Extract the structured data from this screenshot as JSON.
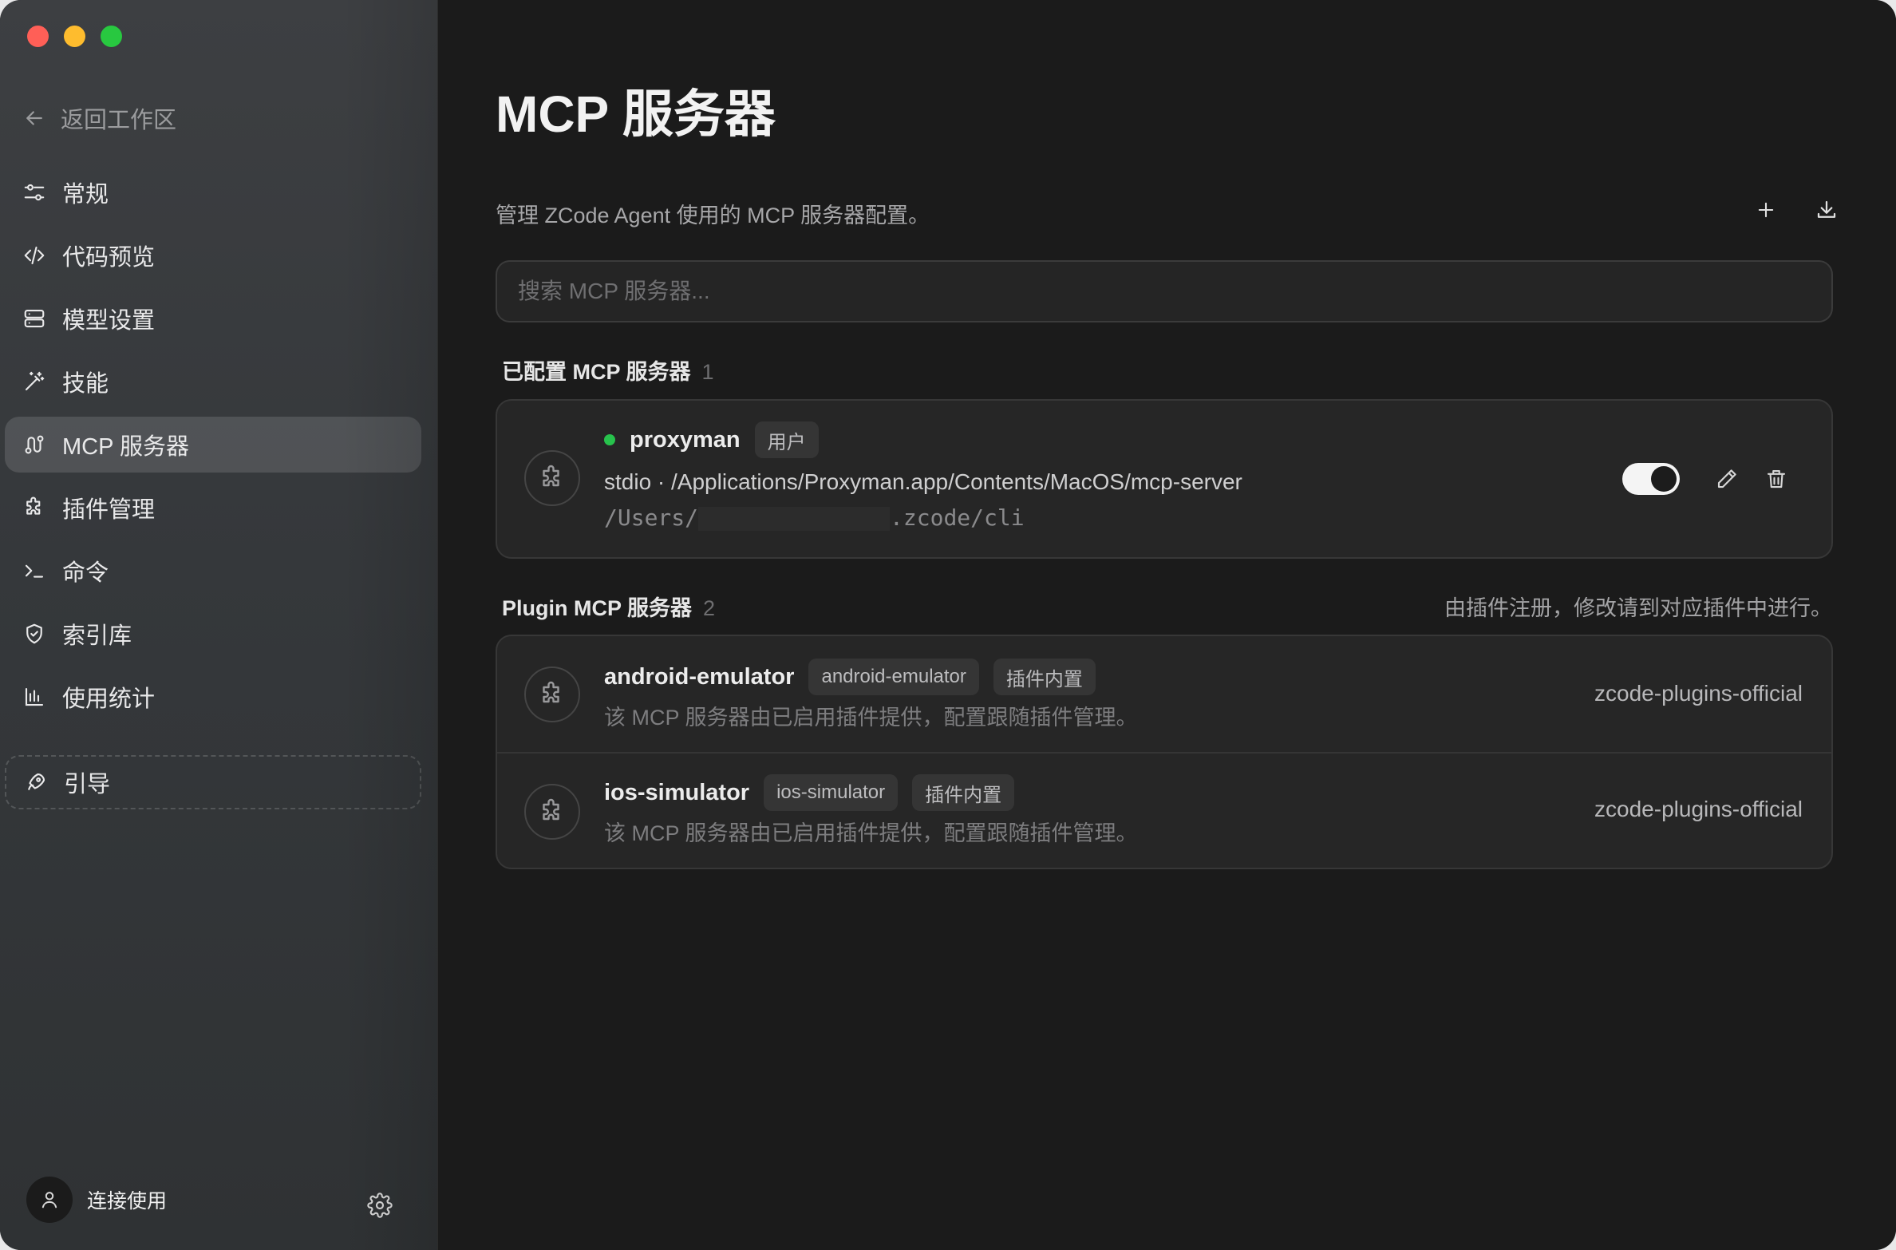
{
  "sidebar": {
    "back_label": "返回工作区",
    "items": [
      {
        "label": "常规",
        "icon": "sliders-icon"
      },
      {
        "label": "代码预览",
        "icon": "code-icon"
      },
      {
        "label": "模型设置",
        "icon": "server-icon"
      },
      {
        "label": "技能",
        "icon": "magic-wand-icon"
      },
      {
        "label": "MCP 服务器",
        "icon": "route-icon",
        "active": true
      },
      {
        "label": "插件管理",
        "icon": "puzzle-icon"
      },
      {
        "label": "命令",
        "icon": "terminal-icon"
      },
      {
        "label": "索引库",
        "icon": "shield-icon"
      },
      {
        "label": "使用统计",
        "icon": "bar-chart-icon"
      }
    ],
    "guide_label": "引导",
    "user_label": "连接使用"
  },
  "main": {
    "title": "MCP 服务器",
    "description": "管理 ZCode Agent 使用的 MCP 服务器配置。",
    "search_placeholder": "搜索 MCP 服务器...",
    "configured": {
      "title": "已配置 MCP 服务器",
      "count": "1",
      "servers": [
        {
          "name": "proxyman",
          "badge": "用户",
          "status": "running",
          "command": "stdio · /Applications/Proxyman.app/Contents/MacOS/mcp-server",
          "path_prefix": "/Users/",
          "path_suffix": ".zcode/cli",
          "enabled": true
        }
      ]
    },
    "plugin": {
      "title": "Plugin MCP 服务器",
      "count": "2",
      "note": "由插件注册，修改请到对应插件中进行。",
      "servers": [
        {
          "name": "android-emulator",
          "badges": [
            "android-emulator",
            "插件内置"
          ],
          "description": "该 MCP 服务器由已启用插件提供，配置跟随插件管理。",
          "source": "zcode-plugins-official"
        },
        {
          "name": "ios-simulator",
          "badges": [
            "ios-simulator",
            "插件内置"
          ],
          "description": "该 MCP 服务器由已启用插件提供，配置跟随插件管理。",
          "source": "zcode-plugins-official"
        }
      ]
    }
  },
  "colors": {
    "status_running": "#27c24c",
    "close": "#ff5f57",
    "minimize": "#febc2e",
    "maximize": "#28c840"
  }
}
